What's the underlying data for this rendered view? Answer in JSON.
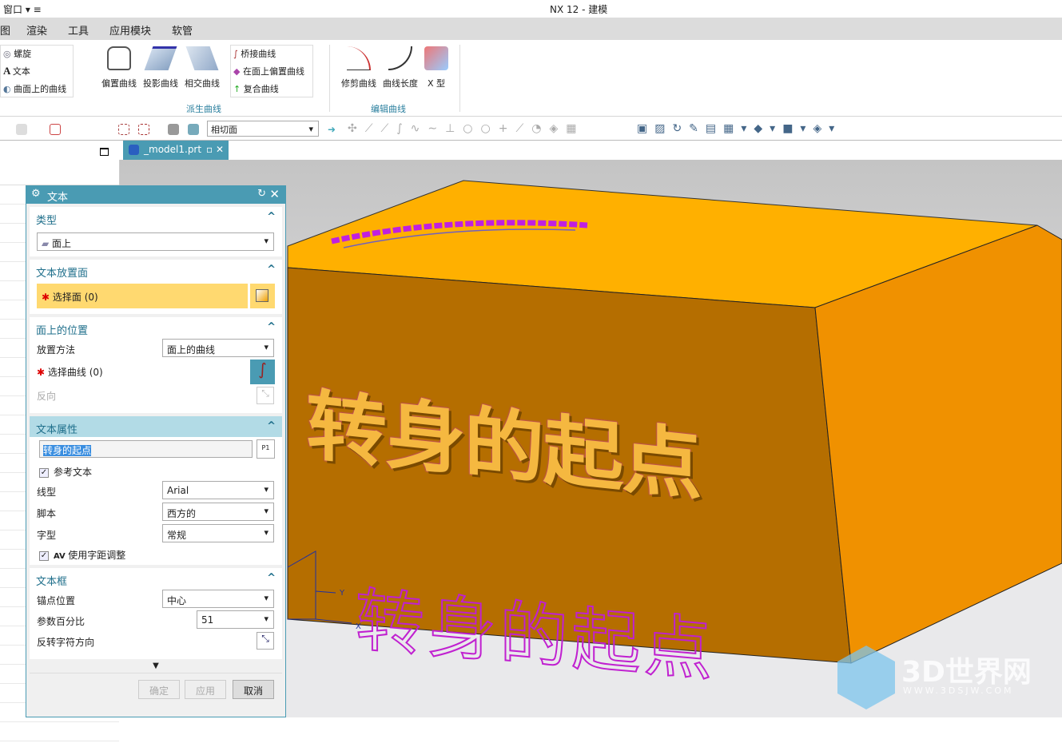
{
  "titlebar": {
    "window_menu": "窗口 ▾ ≡",
    "title": "NX 12 - 建模"
  },
  "menubar": [
    "图",
    "渲染",
    "工具",
    "应用模块",
    "软管"
  ],
  "ribbon": {
    "curve_list": [
      "螺旋",
      "文本",
      "曲面上的曲线"
    ],
    "derived": [
      "偏置曲线",
      "投影曲线",
      "相交曲线"
    ],
    "derived_list": [
      "桥接曲线",
      "在面上偏置曲线",
      "复合曲线"
    ],
    "derived_group": "派生曲线",
    "edit": [
      "修剪曲线",
      "曲线长度",
      "X 型"
    ],
    "edit_group": "编辑曲线"
  },
  "toolbar": {
    "filter_value": "相切面"
  },
  "tab": {
    "label": "_model1.prt"
  },
  "dialog": {
    "title": "文本",
    "type": {
      "header": "类型",
      "value": "面上"
    },
    "face": {
      "header": "文本放置面",
      "select": "选择面 (0)"
    },
    "position": {
      "header": "面上的位置",
      "method_label": "放置方法",
      "method_value": "面上的曲线",
      "select_curve": "选择曲线 (0)",
      "reverse": "反向"
    },
    "props": {
      "header": "文本属性",
      "text": "转身的起点",
      "ref_text": "参考文本",
      "line_label": "线型",
      "line_value": "Arial",
      "script_label": "脚本",
      "script_value": "西方的",
      "style_label": "字型",
      "style_value": "常规",
      "kerning": "使用字距调整"
    },
    "frame": {
      "header": "文本框",
      "anchor_label": "锚点位置",
      "anchor_value": "中心",
      "percent_label": "参数百分比",
      "percent_value": "51",
      "flip_label": "反转字符方向"
    },
    "buttons": {
      "ok": "确定",
      "apply": "应用",
      "cancel": "取消"
    }
  },
  "viewport": {
    "model_text": "转身的起点",
    "axis_x": "X",
    "axis_y": "Y"
  },
  "watermark": {
    "brand": "3D世界网",
    "url": "WWW.3DSJW.COM"
  }
}
